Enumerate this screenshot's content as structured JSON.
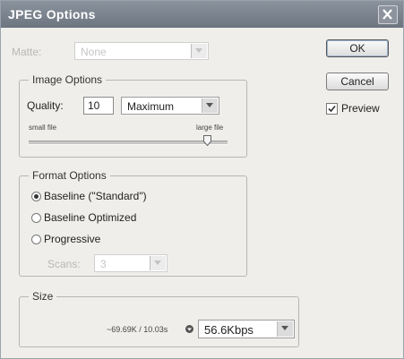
{
  "window": {
    "title": "JPEG Options"
  },
  "matte": {
    "label": "Matte:",
    "value": "None"
  },
  "buttons": {
    "ok": "OK",
    "cancel": "Cancel"
  },
  "preview": {
    "label": "Preview",
    "checked": true
  },
  "image_options": {
    "legend": "Image Options",
    "quality_label": "Quality:",
    "quality_value": "10",
    "quality_preset": "Maximum",
    "small_file_label": "small file",
    "large_file_label": "large file",
    "slider_fraction": 1.0
  },
  "format_options": {
    "legend": "Format Options",
    "choices": [
      "Baseline (\"Standard\")",
      "Baseline Optimized",
      "Progressive"
    ],
    "selected_index": 0,
    "scans_label": "Scans:",
    "scans_value": "3"
  },
  "size": {
    "legend": "Size",
    "readout": "~69.69K / 10.03s",
    "rate": "56.6Kbps"
  },
  "colors": {
    "titlebar": "#7a828c",
    "panel": "#efeeea"
  },
  "icons": {
    "close": "close-icon",
    "arrow": "chevron-down-icon",
    "check": "checkmark-icon",
    "rate": "dropdown-icon"
  }
}
